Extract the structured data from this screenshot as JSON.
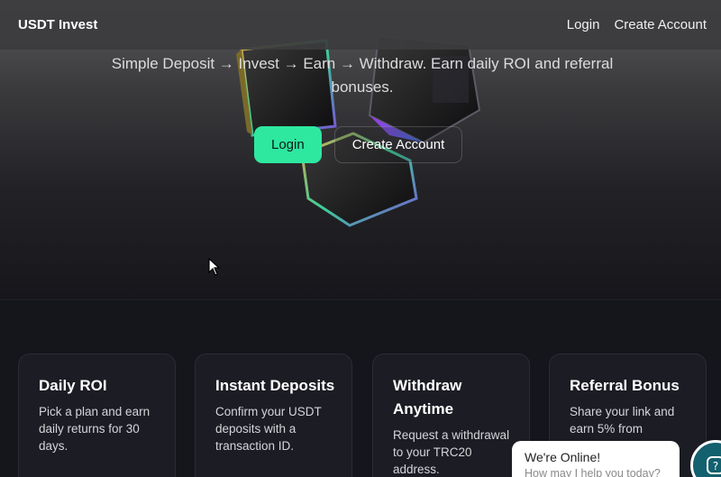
{
  "navbar": {
    "brand": "USDT Invest",
    "links": [
      "Login",
      "Create Account"
    ]
  },
  "hero": {
    "tagline": "Simple Deposit → Invest → Earn → Withdraw. Earn daily ROI and referral bonuses.",
    "primary_button": "Login",
    "secondary_button": "Create Account"
  },
  "features": [
    {
      "title": "Daily ROI",
      "desc": "Pick a plan and earn daily returns for 30 days."
    },
    {
      "title": "Instant Deposits",
      "desc": "Confirm your USDT deposits with a transaction ID."
    },
    {
      "title": "Withdraw Anytime",
      "desc": "Request a withdrawal to your TRC20 address."
    },
    {
      "title": "Referral Bonus",
      "desc": "Share your link and earn 5% from referrals."
    }
  ],
  "chat": {
    "title": "We're Online!",
    "subtitle": "How may I help you today?"
  },
  "colors": {
    "accent": "#2ee8a0",
    "background": "#15151c",
    "card": "#1c1c24"
  }
}
